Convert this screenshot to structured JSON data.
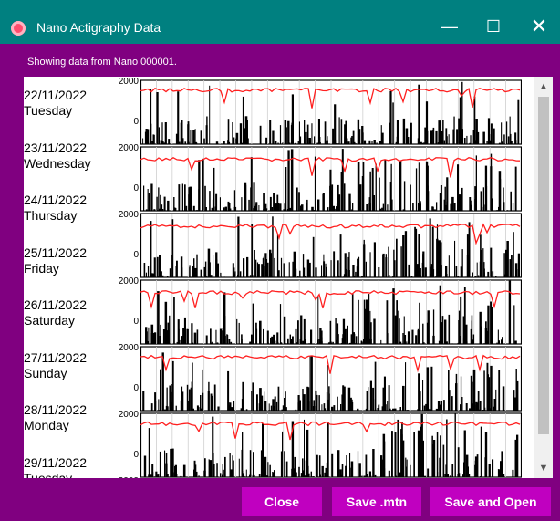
{
  "window": {
    "title": "Nano Actigraphy Data",
    "minimize_glyph": "—",
    "maximize_glyph": "☐",
    "close_glyph": "✕"
  },
  "status": {
    "text": "Showing data from Nano 000001."
  },
  "days": [
    {
      "date": "22/11/2022",
      "weekday": "Tuesday"
    },
    {
      "date": "23/11/2022",
      "weekday": "Wednesday"
    },
    {
      "date": "24/11/2022",
      "weekday": "Thursday"
    },
    {
      "date": "25/11/2022",
      "weekday": "Friday"
    },
    {
      "date": "26/11/2022",
      "weekday": "Saturday"
    },
    {
      "date": "27/11/2022",
      "weekday": "Sunday"
    },
    {
      "date": "28/11/2022",
      "weekday": "Monday"
    },
    {
      "date": "29/11/2022",
      "weekday": "Tuesday"
    }
  ],
  "axis": {
    "max_label": "2000",
    "min_label": "0"
  },
  "buttons": {
    "close": "Close",
    "save_mtn": "Save .mtn",
    "save_open": "Save and Open"
  },
  "scrollbar": {
    "up": "▲",
    "down": "▼"
  },
  "colors": {
    "titlebar": "#008080",
    "window": "#800080",
    "button": "#c000c0",
    "trace": "#ff2020"
  }
}
